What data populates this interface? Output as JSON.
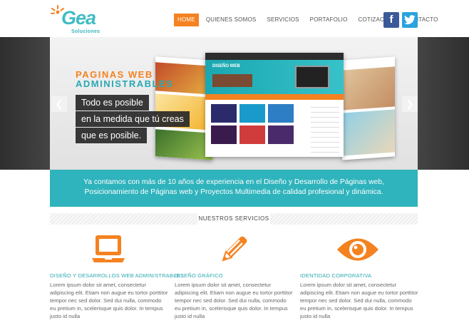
{
  "brand": {
    "logo_word": "Gea",
    "logo_sub": "Soluciones",
    "accent": "#f58220",
    "teal": "#2fb3bc"
  },
  "nav": {
    "items": [
      {
        "label": "HOME",
        "active": true
      },
      {
        "label": "QUIENES SOMOS",
        "active": false
      },
      {
        "label": "SERVICIOS",
        "active": false
      },
      {
        "label": "PORTAFOLIO",
        "active": false
      },
      {
        "label": "COTIZACIÓN",
        "active": false
      },
      {
        "label": "CONTACTO",
        "active": false
      }
    ]
  },
  "social": {
    "facebook_glyph": "f",
    "twitter_glyph": "t",
    "facebook_icon": "facebook-icon",
    "twitter_icon": "twitter-icon"
  },
  "slider": {
    "headline_1": "PAGINAS WEB",
    "headline_2": "ADMINISTRABLES",
    "tagline": [
      "Todo es posible",
      "en la medida que tú creas",
      "que es posible."
    ],
    "prev": "❮",
    "next": "❯",
    "mock_site_title": "DISEÑO WEB"
  },
  "banner": {
    "line_1": "Ya contamos con más de 10 años de experiencia en el Diseño y Desarrollo de Páginas web,",
    "line_2": "Posicionamiento de Páginas web y Proyectos Multimedia de calidad profesional y dinámica."
  },
  "services": {
    "heading": "NUESTROS SERVICIOS",
    "items": [
      {
        "icon": "laptop-icon",
        "title": "DISEÑO Y DESARROLLOS WEB ADMINISTRABLES",
        "text": "Lorem ipsum dolor sit amet, consectetur adipiscing elit. Etiam non augue eu tortor porttitor tempor nec sed dolor. Sed dui nulla, commodo eu pretium in, scelerisque quis dolor. In tempus justo id nulla"
      },
      {
        "icon": "pencil-icon",
        "title": "DISEÑO GRÁFICO",
        "text": "Lorem ipsum dolor sit amet, consectetur adipiscing elit. Etiam non augue eu tortor porttitor tempor nec sed dolor. Sed dui nulla, commodo eu pretium in, scelerisque quis dolor. In tempus justo id nulla"
      },
      {
        "icon": "eye-icon",
        "title": "IDENTIDAD CORPORATIVA",
        "text": "Lorem ipsum dolor sit amet, consectetur adipiscing elit. Etiam non augue eu tortor porttitor tempor nec sed dolor. Sed dui nulla, commodo eu pretium in, scelerisque quis dolor. In tempus justo id nulla"
      }
    ]
  }
}
